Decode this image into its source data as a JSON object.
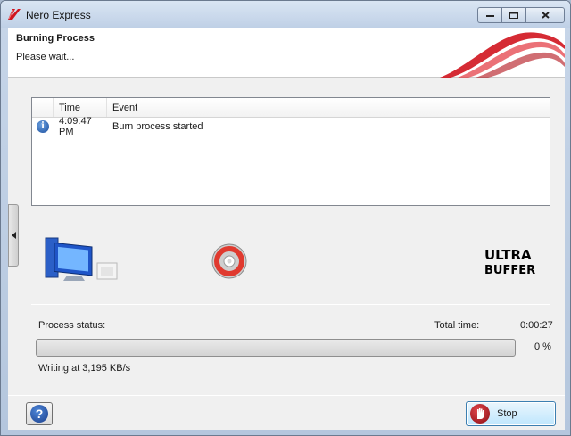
{
  "window": {
    "title": "Nero Express"
  },
  "header": {
    "title": "Burning Process",
    "subtitle": "Please wait..."
  },
  "log": {
    "columns": [
      "Time",
      "Event"
    ],
    "rows": [
      {
        "icon": "info-icon",
        "time": "4:09:47 PM",
        "event": "Burn process started"
      }
    ]
  },
  "status": {
    "process_status_label": "Process status:",
    "total_time_label": "Total time:",
    "total_time_value": "0:00:27",
    "progress_percent_label": "0 %",
    "progress_value": 0,
    "writing_speed": "Writing at 3,195 KB/s"
  },
  "logos": {
    "ultrabuffer_line1": "ULTRA",
    "ultrabuffer_line2": "BUFFER"
  },
  "buttons": {
    "help_label": "?",
    "stop_label": "Stop"
  },
  "colors": {
    "brand_red": "#d0141e",
    "progress_green": "#3fae3a",
    "stop_border": "#3c7fb1"
  }
}
